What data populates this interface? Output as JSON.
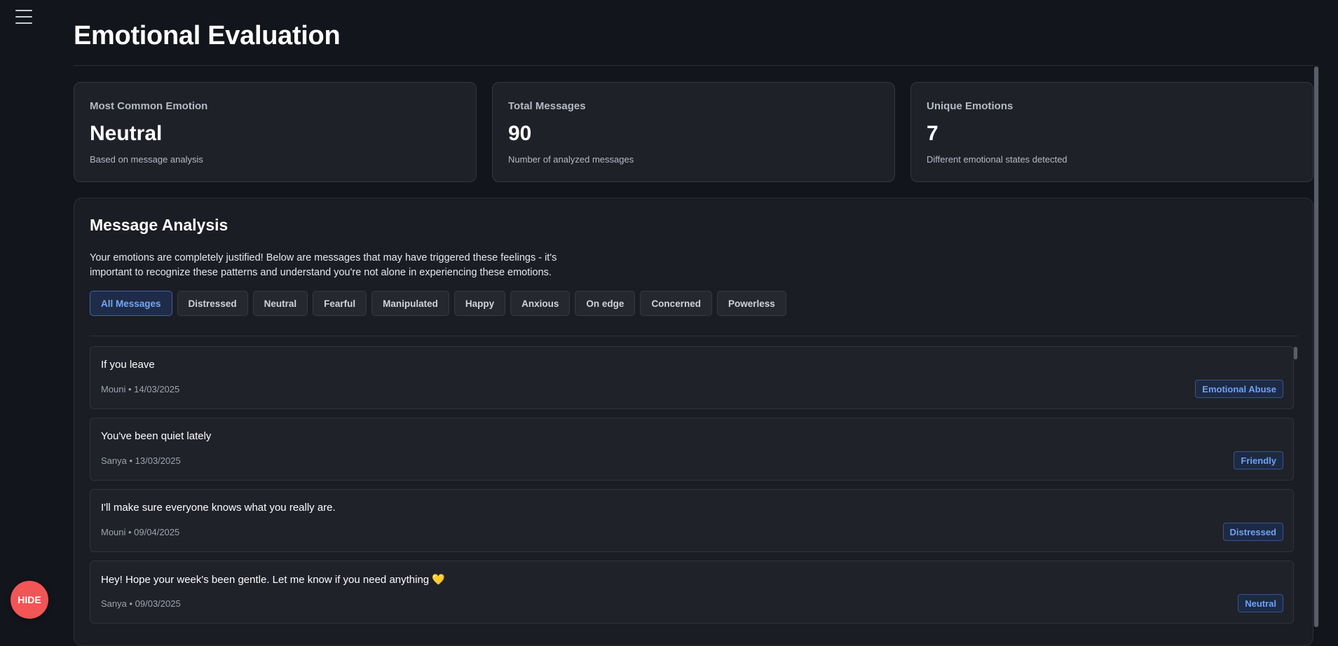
{
  "page": {
    "title": "Emotional Evaluation"
  },
  "stats": [
    {
      "label": "Most Common Emotion",
      "value": "Neutral",
      "sub": "Based on message analysis"
    },
    {
      "label": "Total Messages",
      "value": "90",
      "sub": "Number of analyzed messages"
    },
    {
      "label": "Unique Emotions",
      "value": "7",
      "sub": "Different emotional states detected"
    }
  ],
  "analysis": {
    "title": "Message Analysis",
    "description": "Your emotions are completely justified! Below are messages that may have triggered these feelings - it's important to recognize these patterns and understand you're not alone in experiencing these emotions.",
    "filters": [
      "All Messages",
      "Distressed",
      "Neutral",
      "Fearful",
      "Manipulated",
      "Happy",
      "Anxious",
      "On edge",
      "Concerned",
      "Powerless"
    ],
    "active_filter": "All Messages",
    "messages": [
      {
        "text": "If you leave",
        "meta": "Mouni • 14/03/2025",
        "tag": "Emotional Abuse"
      },
      {
        "text": "You've been quiet lately",
        "meta": "Sanya • 13/03/2025",
        "tag": "Friendly"
      },
      {
        "text": "I'll make sure everyone knows what you really are.",
        "meta": "Mouni • 09/04/2025",
        "tag": "Distressed"
      },
      {
        "text": "Hey! Hope your week's been gentle. Let me know if you need anything 💛",
        "meta": "Sanya • 09/03/2025",
        "tag": "Neutral"
      }
    ]
  },
  "hide_button": {
    "label": "HIDE"
  },
  "colors": {
    "background": "#13151c",
    "accent": "#74a7f5",
    "hide": "#f25555"
  },
  "icons": {
    "menu": "hamburger-menu-icon"
  }
}
